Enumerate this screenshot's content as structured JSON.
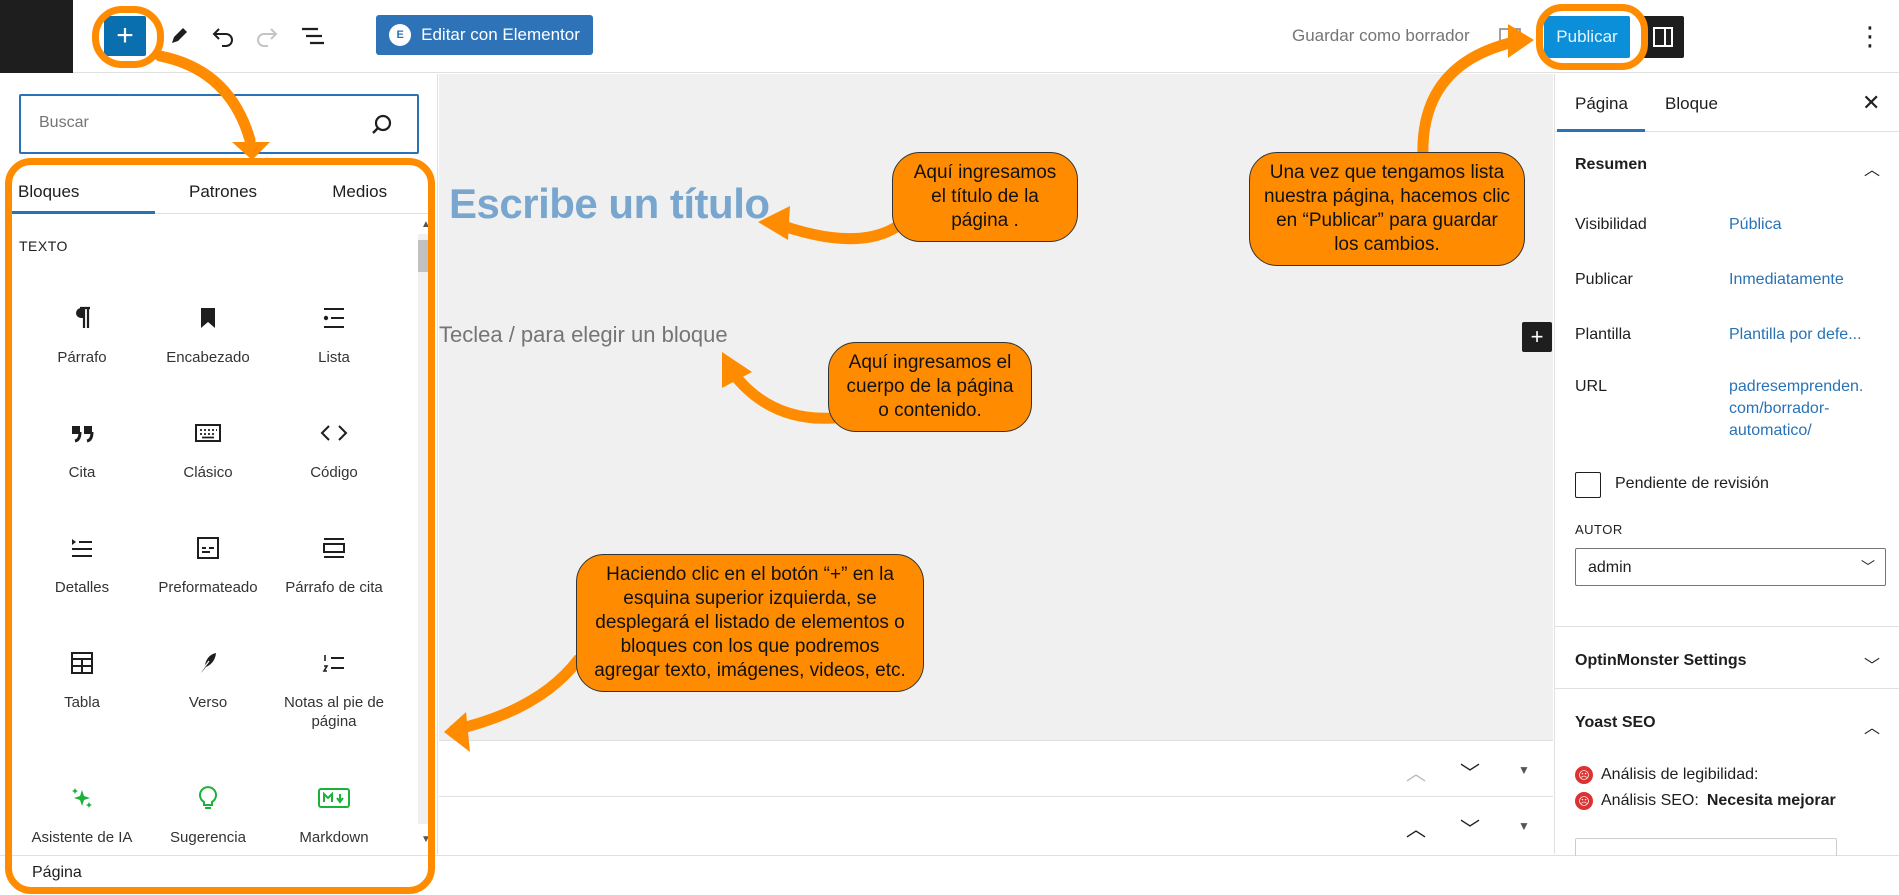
{
  "toolbar": {
    "add_block_label": "+",
    "edit_with_elementor": "Editar con Elementor",
    "elementor_badge": "E",
    "save_draft": "Guardar como borrador",
    "publish": "Publicar",
    "more_label": "⋮"
  },
  "inserter": {
    "search_placeholder": "Buscar",
    "tabs": [
      {
        "label": "Bloques",
        "active": true
      },
      {
        "label": "Patrones",
        "active": false
      },
      {
        "label": "Medios",
        "active": false
      }
    ],
    "category": "TEXTO",
    "blocks": [
      {
        "label": "Párrafo",
        "icon": "paragraph-icon"
      },
      {
        "label": "Encabezado",
        "icon": "bookmark-icon"
      },
      {
        "label": "Lista",
        "icon": "list-icon"
      },
      {
        "label": "Cita",
        "icon": "quote-icon"
      },
      {
        "label": "Clásico",
        "icon": "keyboard-icon"
      },
      {
        "label": "Código",
        "icon": "code-icon"
      },
      {
        "label": "Detalles",
        "icon": "details-icon"
      },
      {
        "label": "Preformateado",
        "icon": "preformatted-icon"
      },
      {
        "label": "Párrafo de cita",
        "icon": "pullquote-icon"
      },
      {
        "label": "Tabla",
        "icon": "table-icon"
      },
      {
        "label": "Verso",
        "icon": "feather-icon"
      },
      {
        "label": "Notas al pie de página",
        "icon": "footnotes-icon"
      },
      {
        "label": "Asistente de IA",
        "icon": "sparkles-icon"
      },
      {
        "label": "Sugerencia",
        "icon": "lightbulb-icon"
      },
      {
        "label": "Markdown",
        "icon": "markdown-icon"
      }
    ],
    "colors": {
      "ai_green": "#1bb23a"
    }
  },
  "status_bar": {
    "label": "Página"
  },
  "editor": {
    "title_placeholder": "Escribe un título",
    "block_placeholder": "Teclea / para elegir un bloque",
    "canvas_add_label": "+"
  },
  "settings": {
    "tabs": [
      "Página",
      "Bloque"
    ],
    "close_label": "✕",
    "summary": {
      "heading": "Resumen",
      "rows": [
        {
          "label": "Visibilidad",
          "value": "Pública"
        },
        {
          "label": "Publicar",
          "value": "Inmediatamente"
        },
        {
          "label": "Plantilla",
          "value": "Plantilla por defe..."
        },
        {
          "label": "URL",
          "value_lines": [
            "padresemprenden.",
            "com/borrador-",
            "automatico/"
          ]
        }
      ],
      "pending_review": "Pendiente de revisión",
      "author_label": "AUTOR",
      "author_value": "admin"
    },
    "optinmonster_heading": "OptinMonster Settings",
    "yoast": {
      "heading": "Yoast SEO",
      "readability": "Análisis de legibilidad:",
      "seo_prefix": "Análisis SEO:",
      "seo_status": "Necesita mejorar"
    }
  },
  "annotations": {
    "title_note": "Aquí ingresamos el título de la página .",
    "body_note": "Aquí ingresamos el cuerpo de la página o contenido.",
    "publish_note": "Una vez que tengamos lista nuestra página, hacemos clic en “Publicar” para guardar los cambios.",
    "plus_note": "Haciendo clic en el botón “+” en la esquina superior izquierda, se desplegará el listado de elementos o bloques con los que podremos agregar texto, imágenes, videos, etc.",
    "color": "#ff8c00"
  },
  "colors": {
    "accent": "#2a72b6",
    "publish": "#0a8fd8",
    "elementor": "#2e73b8",
    "title_placeholder": "#78a6cf",
    "error": "#dc3232"
  }
}
